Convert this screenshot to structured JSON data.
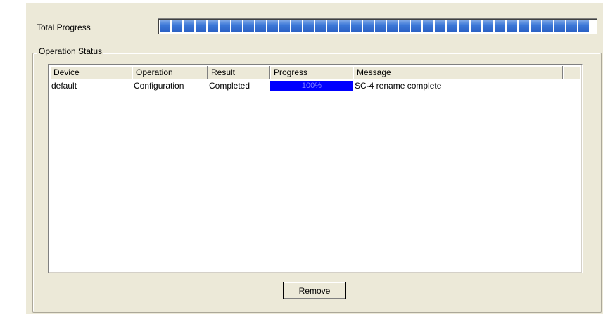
{
  "total_progress": {
    "label": "Total Progress",
    "value_fraction": 1.0
  },
  "operation_status": {
    "legend": "Operation Status",
    "columns": [
      "Device",
      "Operation",
      "Result",
      "Progress",
      "Message"
    ],
    "rows": [
      {
        "device": "default",
        "operation": "Configuration",
        "result": "Completed",
        "progress_fraction": 1.0,
        "progress_text": "100%",
        "message": "SC-4 rename complete"
      }
    ]
  },
  "buttons": {
    "remove_label": "Remove"
  },
  "colors": {
    "dialog_bg": "#ece9d8",
    "progress_blue": "#2a5fc2",
    "cell_progress_blue": "#0000ff"
  }
}
